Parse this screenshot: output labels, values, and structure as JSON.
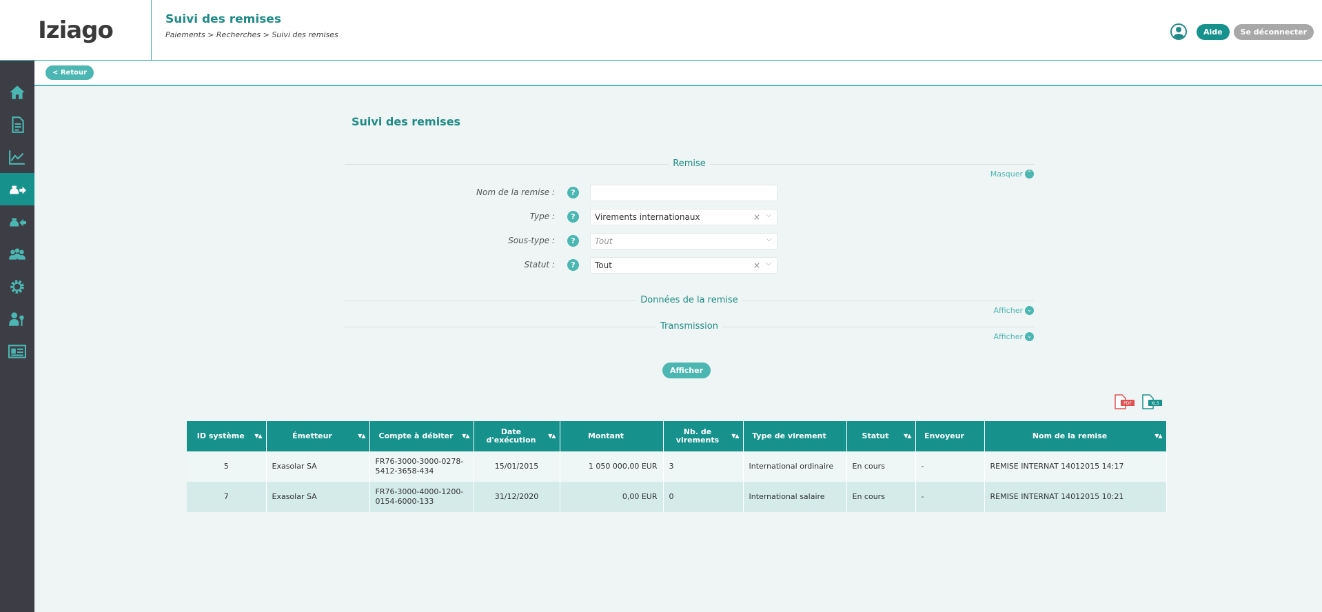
{
  "header": {
    "logo": "Iziago",
    "title": "Suivi des remises",
    "breadcrumb": "Paiements > Recherches > Suivi des remises",
    "help_label": "Aide",
    "logout_label": "Se déconnecter"
  },
  "subbar": {
    "back_label": "< Retour"
  },
  "sidebar": {
    "items": [
      {
        "icon": "home-icon"
      },
      {
        "icon": "document-icon"
      },
      {
        "icon": "chart-icon"
      },
      {
        "icon": "outgoing-payment-icon",
        "active": true
      },
      {
        "icon": "incoming-payment-icon"
      },
      {
        "icon": "users-icon"
      },
      {
        "icon": "gear-icon"
      },
      {
        "icon": "user-key-icon"
      },
      {
        "icon": "id-card-icon"
      }
    ]
  },
  "main": {
    "title": "Suivi des remises",
    "sections": {
      "remise": {
        "label": "Remise",
        "toggle": "Masquer"
      },
      "donnees": {
        "label": "Données de la remise",
        "toggle": "Afficher"
      },
      "transmission": {
        "label": "Transmission",
        "toggle": "Afficher"
      }
    },
    "form": {
      "nom": {
        "label": "Nom de la remise :",
        "value": ""
      },
      "type": {
        "label": "Type :",
        "value": "Virements internationaux"
      },
      "soustype": {
        "label": "Sous-type :",
        "placeholder": "Tout"
      },
      "statut": {
        "label": "Statut :",
        "value": "Tout"
      }
    },
    "show_button": "Afficher",
    "export": {
      "pdf": "PDF",
      "xls": "XLS"
    },
    "table": {
      "headers": [
        "ID système",
        "Émetteur",
        "Compte à débiter",
        "Date d'exécution",
        "Montant",
        "Nb. de virements",
        "Type de virement",
        "Statut",
        "Envoyeur",
        "Nom de la remise"
      ],
      "rows": [
        [
          "5",
          "Exasolar SA",
          "FR76-3000-3000-0278-5412-3658-434",
          "15/01/2015",
          "1 050 000,00 EUR",
          "3",
          "International ordinaire",
          "En cours",
          "-",
          "REMISE INTERNAT 14012015 14:17"
        ],
        [
          "7",
          "Exasolar SA",
          "FR76-3000-4000-1200-0154-6000-133",
          "31/12/2020",
          "0,00 EUR",
          "0",
          "International salaire",
          "En cours",
          "-",
          "REMISE INTERNAT 14012015 10:21"
        ]
      ]
    }
  },
  "colors": {
    "brand": "#17918c",
    "accent": "#4bb6b2",
    "sidebar": "#3d3d45"
  }
}
